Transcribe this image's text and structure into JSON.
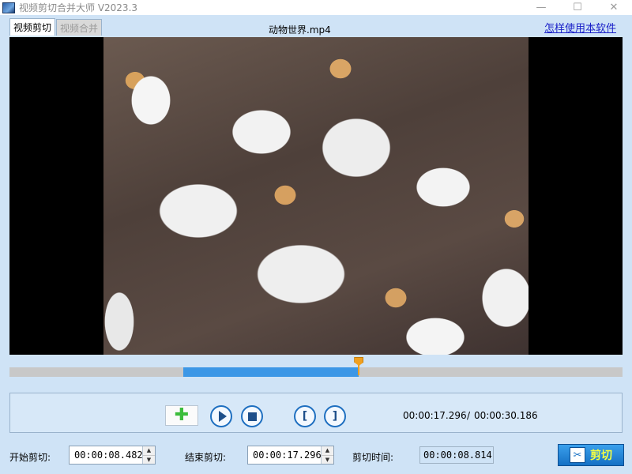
{
  "window": {
    "title": "视频剪切合并大师 V2023.3",
    "minimize": "—",
    "maximize": "☐",
    "close": "✕"
  },
  "tabs": [
    {
      "label": "视频剪切",
      "active": true
    },
    {
      "label": "视频合并",
      "active": false
    }
  ],
  "file_name": "动物世界.mp4",
  "help_link": "怎样使用本软件",
  "timeline": {
    "selection_start_fraction": 0.283,
    "selection_end_fraction": 0.57,
    "playhead_fraction": 0.57
  },
  "controls": {
    "add_icon": "✚",
    "mark_in_label": "[",
    "mark_out_label": "]",
    "current_time": "00:00:17.296",
    "separator": "/",
    "total_time": "00:00:30.186"
  },
  "bottom": {
    "start_label": "开始剪切:",
    "start_value": "00:00:08.482",
    "end_label": "结束剪切:",
    "end_value": "00:00:17.296",
    "duration_label": "剪切时间:",
    "duration_value": "00:00:08.814",
    "cut_button_label": "剪切",
    "spin_up": "▲",
    "spin_down": "▼"
  },
  "colors": {
    "background": "#cfe3f6",
    "timeline_selection": "#3c97e6",
    "playhead": "#f0a020",
    "cut_button": "#1570c4",
    "cut_text": "#f6ff40",
    "link": "#1a20c8"
  }
}
